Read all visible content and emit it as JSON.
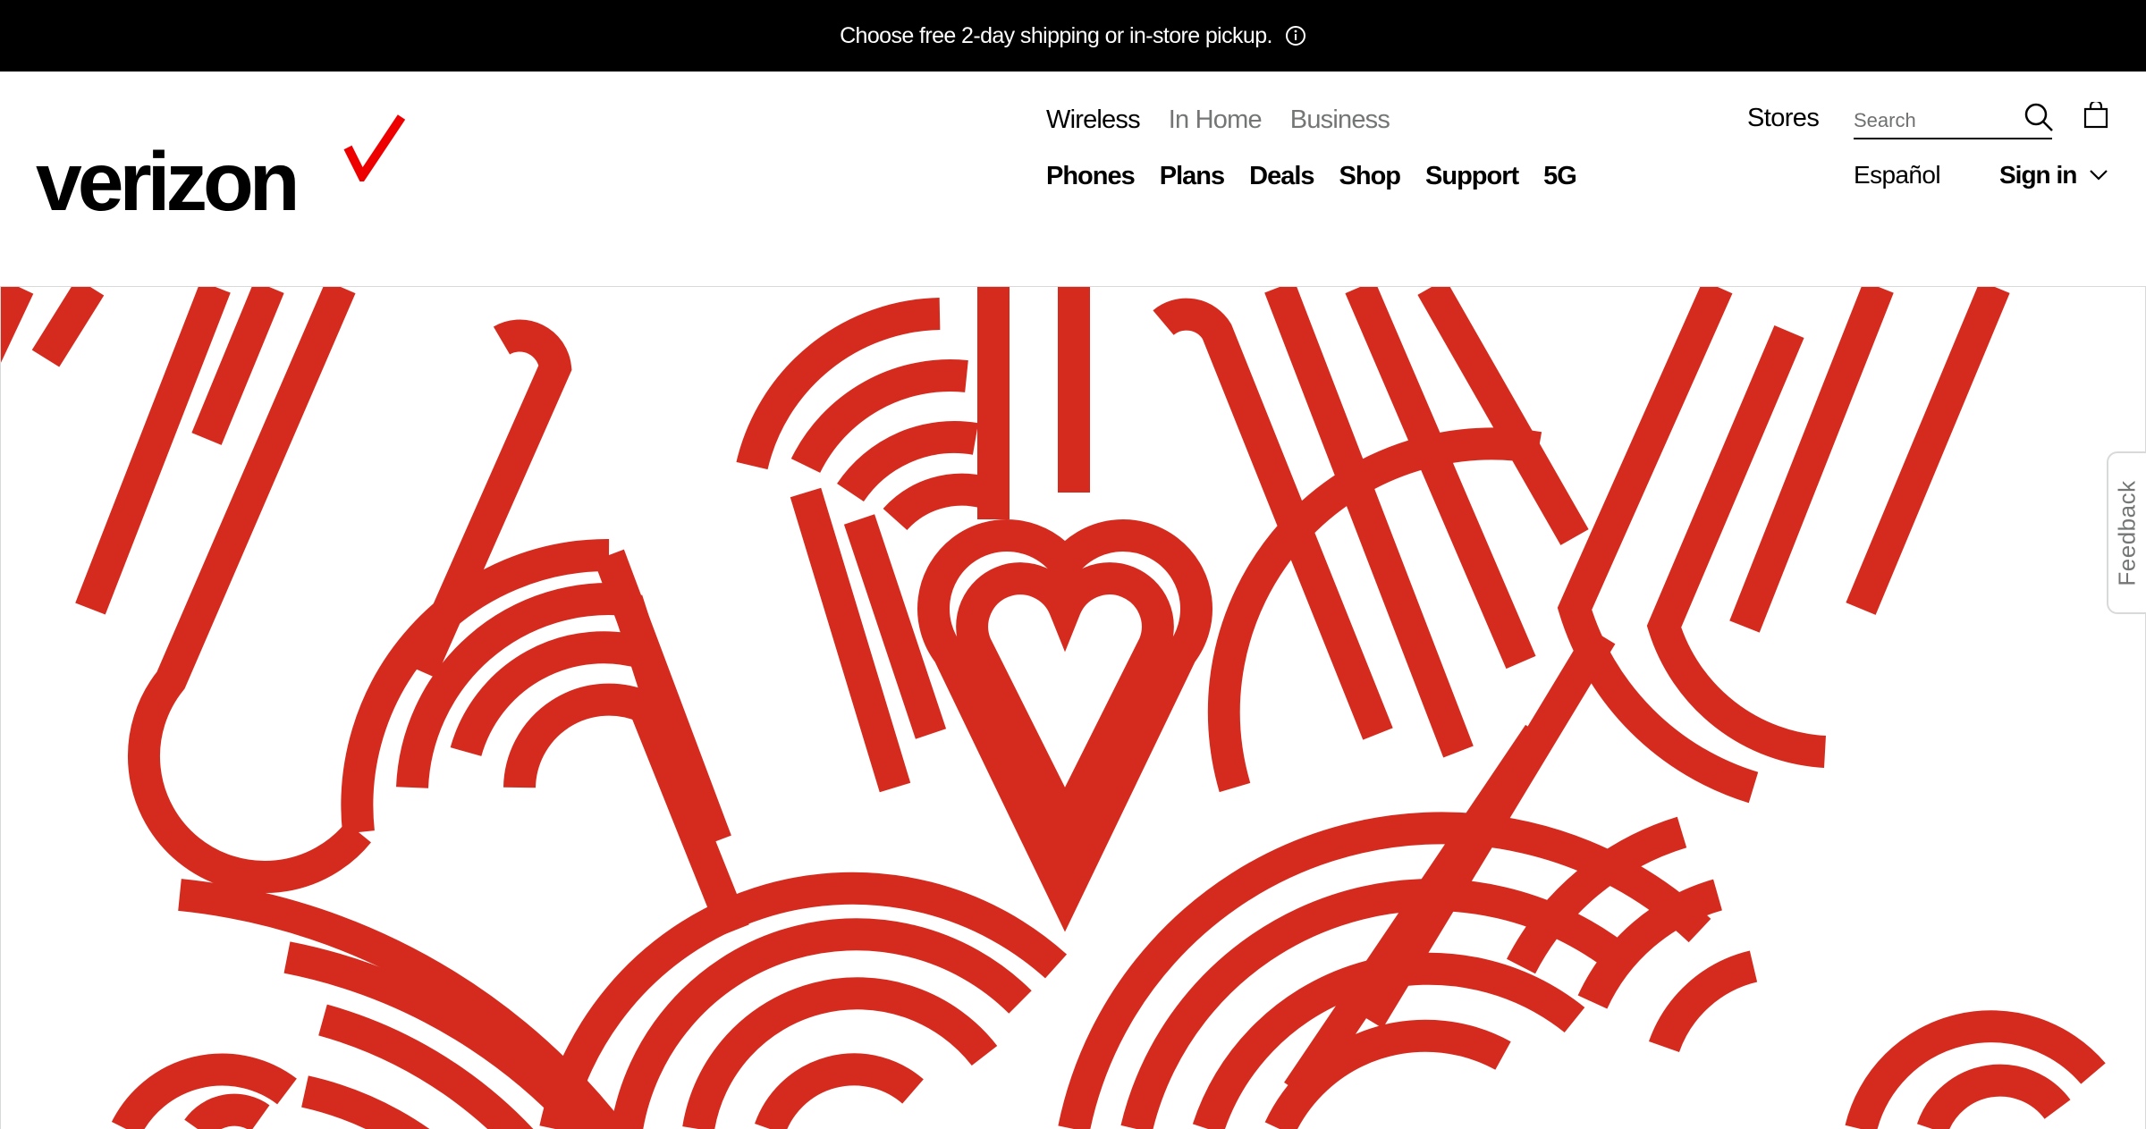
{
  "banner": {
    "text": "Choose free 2-day shipping or in-store pickup.",
    "icon": "info-icon"
  },
  "logo": {
    "word": "verizon",
    "check_color": "#ee0000"
  },
  "nav": {
    "segments": [
      {
        "label": "Wireless",
        "active": true
      },
      {
        "label": "In Home",
        "active": false
      },
      {
        "label": "Business",
        "active": false
      }
    ],
    "main": [
      "Phones",
      "Plans",
      "Deals",
      "Shop",
      "Support",
      "5G"
    ]
  },
  "utility": {
    "stores": "Stores",
    "search_placeholder": "Search",
    "espanol": "Español",
    "signin": "Sign in"
  },
  "feedback": "Feedback",
  "colors": {
    "brand_red": "#d52b1e",
    "black": "#000000",
    "gray": "#747676"
  }
}
